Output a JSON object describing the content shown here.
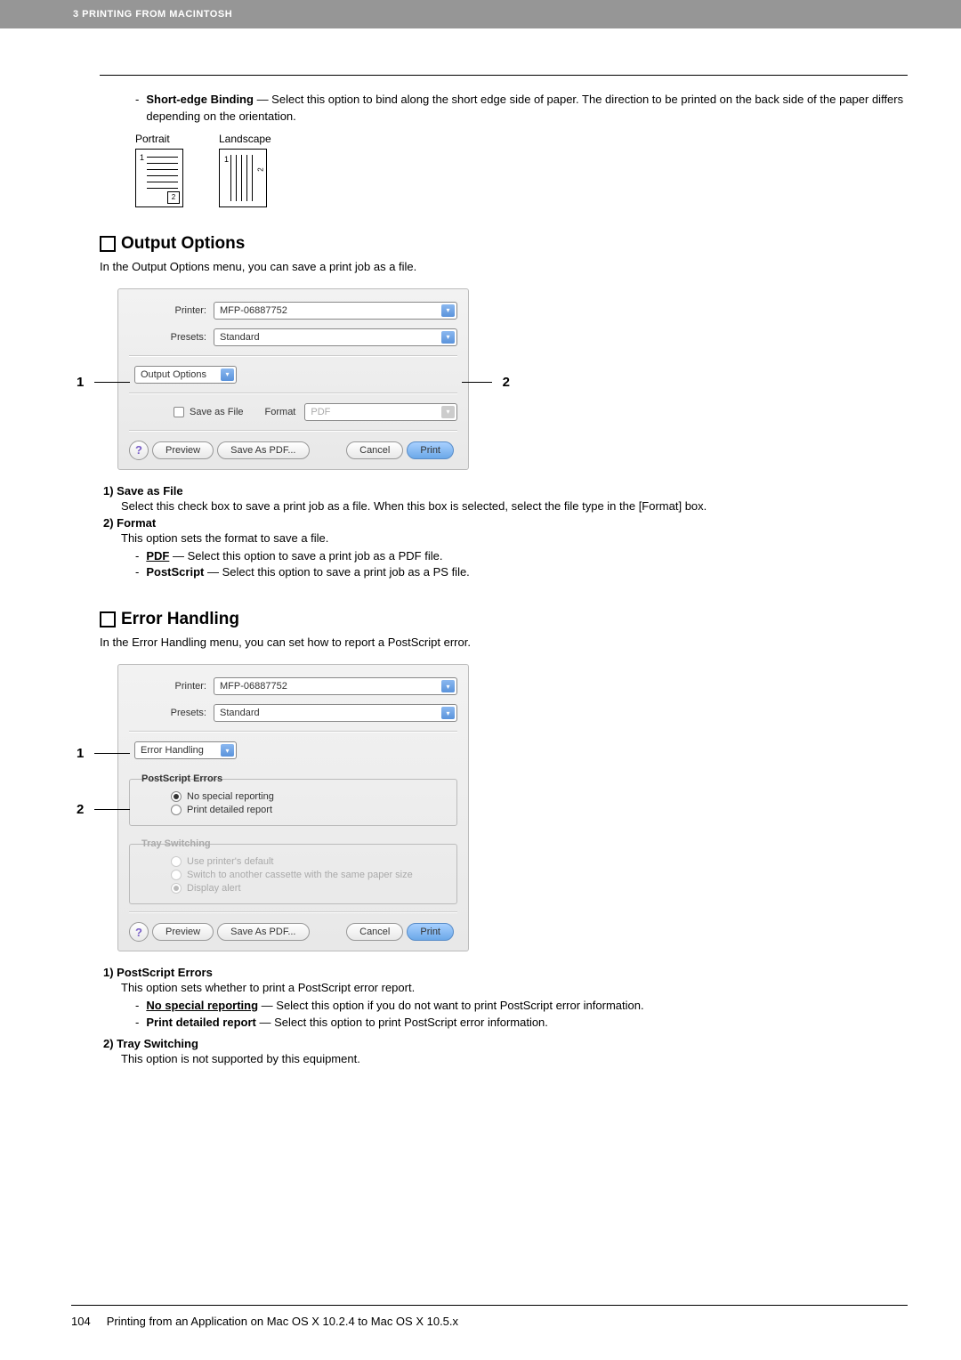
{
  "header": {
    "chapter": "3 PRINTING FROM MACINTOSH"
  },
  "shortEdge": {
    "title": "Short-edge Binding",
    "desc": " — Select this option to bind along the short edge side of paper. The direction to be printed on the back side of the paper differs depending on the orientation.",
    "portrait": "Portrait",
    "landscape": "Landscape"
  },
  "output": {
    "heading": "Output Options",
    "intro": "In the Output Options menu, you can save a print job as a file.",
    "callout1": "1",
    "callout2": "2"
  },
  "dialog1": {
    "printerLabel": "Printer:",
    "printerValue": "MFP-06887752",
    "presetsLabel": "Presets:",
    "presetsValue": "Standard",
    "panel": "Output Options",
    "saveAsFile": "Save as File",
    "formatLabel": "Format",
    "formatValue": "PDF",
    "help": "?",
    "preview": "Preview",
    "savePdf": "Save As PDF...",
    "cancel": "Cancel",
    "print": "Print"
  },
  "outputList": {
    "i1head": "1)  Save as File",
    "i1body": "Select this check box to save a print job as a file. When this box is selected, select the file type in the [Format] box.",
    "i2head": "2)  Format",
    "i2body": "This option sets the format to save a file.",
    "pdfLabel": "PDF",
    "pdfDesc": " — Select this option to save a print job as a PDF file.",
    "psLabel": "PostScript",
    "psDesc": " — Select this option to save a print job as a PS file."
  },
  "error": {
    "heading": "Error Handling",
    "intro": "In the Error Handling menu, you can set how to report a PostScript error.",
    "callout1": "1",
    "callout2": "2"
  },
  "dialog2": {
    "printerLabel": "Printer:",
    "printerValue": "MFP-06887752",
    "presetsLabel": "Presets:",
    "presetsValue": "Standard",
    "panel": "Error Handling",
    "group1": "PostScript Errors",
    "r1": "No special reporting",
    "r2": "Print detailed report",
    "group2": "Tray Switching",
    "r3": "Use printer's default",
    "r4": "Switch to another cassette with the same paper size",
    "r5": "Display alert",
    "help": "?",
    "preview": "Preview",
    "savePdf": "Save As PDF...",
    "cancel": "Cancel",
    "print": "Print"
  },
  "errorList": {
    "i1head": "1)  PostScript Errors",
    "i1body": "This option sets whether to print a PostScript error report.",
    "nsLabel": "No special reporting",
    "nsDesc": " — Select this option if you do not want to print PostScript error information.",
    "pdLabel": "Print detailed report",
    "pdDesc": " — Select this option to print PostScript error information.",
    "i2head": "2)  Tray Switching",
    "i2body": "This option is not supported by this equipment."
  },
  "footer": {
    "pagenum": "104",
    "title": "Printing from an Application on Mac OS X 10.2.4 to Mac OS X 10.5.x"
  }
}
